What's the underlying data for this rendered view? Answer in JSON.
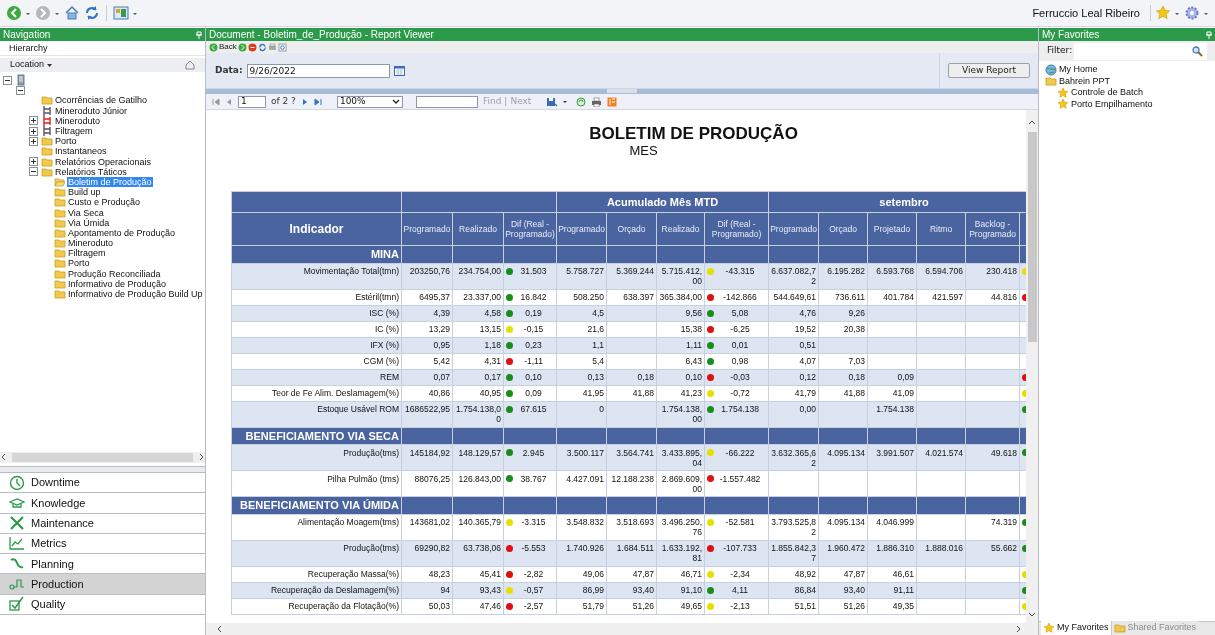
{
  "top_bar": {
    "user_name": "Ferruccio Leal Ribeiro"
  },
  "navigation": {
    "title": "Navigation",
    "mode": "Hierarchy",
    "location": "Location",
    "tree": [
      {
        "kind": "server",
        "expanded": true,
        "children": [
          {
            "expanded": true,
            "children": [
              {
                "label": "Ocorrências de Gatilho",
                "kind": "folder",
                "selected": false
              },
              {
                "label": "Mineroduto Júnior",
                "kind": "unit",
                "selected": false
              },
              {
                "label": "Mineroduto",
                "kind": "alert-unit",
                "expanded": false,
                "selected": false
              },
              {
                "label": "Filtragem",
                "kind": "unit",
                "expanded": false,
                "selected": false
              },
              {
                "label": "Porto",
                "kind": "folder",
                "expanded": false,
                "selected": false
              },
              {
                "label": "Instantaneos",
                "kind": "folder",
                "selected": false
              },
              {
                "label": "Relatórios Operacionais",
                "kind": "folder",
                "expanded": false,
                "selected": false
              },
              {
                "label": "Relatórios Táticos",
                "kind": "folder",
                "expanded": true,
                "selected": false,
                "children": [
                  {
                    "label": "Boletim de Produção",
                    "kind": "folder",
                    "selected": true
                  },
                  {
                    "label": "Build up",
                    "kind": "folder",
                    "selected": false
                  },
                  {
                    "label": "Custo e Produção",
                    "kind": "folder",
                    "selected": false
                  },
                  {
                    "label": "Via Seca",
                    "kind": "folder",
                    "selected": false
                  },
                  {
                    "label": "Via Úmida",
                    "kind": "folder",
                    "selected": false
                  },
                  {
                    "label": "Apontamento de Produção",
                    "kind": "folder",
                    "selected": false
                  },
                  {
                    "label": "Mineroduto",
                    "kind": "folder",
                    "selected": false
                  },
                  {
                    "label": "Filtragem",
                    "kind": "folder",
                    "selected": false
                  },
                  {
                    "label": "Porto",
                    "kind": "folder",
                    "selected": false
                  },
                  {
                    "label": "Produção Reconciliada",
                    "kind": "folder",
                    "selected": false
                  },
                  {
                    "label": "Informativo de Produção",
                    "kind": "folder",
                    "selected": false
                  },
                  {
                    "label": "Informativo de Produção Build Up",
                    "kind": "folder",
                    "selected": false
                  }
                ]
              }
            ]
          }
        ]
      }
    ],
    "sections": [
      {
        "label": "Downtime",
        "selected": false
      },
      {
        "label": "Knowledge",
        "selected": false
      },
      {
        "label": "Maintenance",
        "selected": false
      },
      {
        "label": "Metrics",
        "selected": false
      },
      {
        "label": "Planning",
        "selected": false
      },
      {
        "label": "Production",
        "selected": true
      },
      {
        "label": "Quality",
        "selected": false
      }
    ]
  },
  "document": {
    "title": "Document - Boletim_de_Produção - Report Viewer",
    "back_label": "Back",
    "parameter": {
      "label": "Data:",
      "value": "9/26/2022"
    },
    "view_report": "View Report",
    "toolbar": {
      "page": "1",
      "page_count": "of 2 ?",
      "zoom": "100%",
      "find": "Find",
      "separator": "|",
      "next": "Next",
      "find_disabled": true
    },
    "report": {
      "title": "BOLETIM DE PRODUÇÃO",
      "subtitle": "MES",
      "table": {
        "indicator_header": "Indicador",
        "groups": [
          {
            "columns": [
              "Programado",
              "Realizado",
              "Dif (Real - Programado)"
            ]
          },
          {
            "label": "Acumulado Mês MTD",
            "columns": [
              "Programado",
              "Orçado",
              "Realizado",
              "Dif (Real - Programado)"
            ]
          },
          {
            "label": "setembro",
            "columns": [
              "Programado",
              "Orçado",
              "Projetado",
              "Ritmo",
              "Backlog - Programado"
            ]
          }
        ],
        "rows": [
          {
            "kind": "section",
            "label": "MINA"
          },
          {
            "kind": "data",
            "label": "Movimentação Total(tmn)",
            "shaded": true,
            "programado": "203250,76",
            "realizado": "234.754,00",
            "dif": {
              "text": "31.503",
              "color": "#1a8c1a"
            },
            "mtd_programado": "5.758.727",
            "mtd_orcado": "5.369.244",
            "mtd_realizado": "5.715.412,00",
            "mtd_dif": {
              "text": "-43.315",
              "color": "#e6e000"
            },
            "set_programado": "6.637.082,72",
            "set_orcado": "6.195.282",
            "set_projetado": "6.593.768",
            "set_ritmo": "6.594.706",
            "set_backlog": "230.418",
            "status": {
              "color": "#e6e000"
            }
          },
          {
            "kind": "data",
            "label": "Estéril(tmn)",
            "shaded": false,
            "programado": "6495,37",
            "realizado": "23.337,00",
            "dif": {
              "text": "16.842",
              "color": "#1a8c1a"
            },
            "mtd_programado": "508.250",
            "mtd_orcado": "638.397",
            "mtd_realizado": "365.384,00",
            "mtd_dif": {
              "text": "-142.866",
              "color": "#e01010"
            },
            "set_programado": "544.649,61",
            "set_orcado": "736.611",
            "set_projetado": "401.784",
            "set_ritmo": "421.597",
            "set_backlog": "44.816",
            "status": {
              "color": "#e01010"
            }
          },
          {
            "kind": "data",
            "label": "ISC (%)",
            "shaded": true,
            "programado": "4,39",
            "realizado": "4,58",
            "dif": {
              "text": "0,19",
              "color": "#1a8c1a"
            },
            "mtd_programado": "4,5",
            "mtd_realizado": "9,56",
            "mtd_dif": {
              "text": "5,08",
              "color": "#1a8c1a"
            },
            "set_programado": "4,76",
            "set_orcado": "9,26"
          },
          {
            "kind": "data",
            "label": "IC (%)",
            "shaded": false,
            "programado": "13,29",
            "realizado": "13,15",
            "dif": {
              "text": "-0,15",
              "color": "#e6e000"
            },
            "mtd_programado": "21,6",
            "mtd_realizado": "15,38",
            "mtd_dif": {
              "text": "-6,25",
              "color": "#e01010"
            },
            "set_programado": "19,52",
            "set_orcado": "20,38"
          },
          {
            "kind": "data",
            "label": "IFX (%)",
            "shaded": true,
            "programado": "0,95",
            "realizado": "1,18",
            "dif": {
              "text": "0,23",
              "color": "#1a8c1a"
            },
            "mtd_programado": "1,1",
            "mtd_realizado": "1,11",
            "mtd_dif": {
              "text": "0,01",
              "color": "#1a8c1a"
            },
            "set_programado": "0,51"
          },
          {
            "kind": "data",
            "label": "CGM (%)",
            "shaded": false,
            "programado": "5,42",
            "realizado": "4,31",
            "dif": {
              "text": "-1,11",
              "color": "#e01010"
            },
            "mtd_programado": "5,4",
            "mtd_realizado": "6,43",
            "mtd_dif": {
              "text": "0,98",
              "color": "#1a8c1a"
            },
            "set_programado": "4,07",
            "set_orcado": "7,03"
          },
          {
            "kind": "data",
            "label": "REM",
            "shaded": true,
            "programado": "0,07",
            "realizado": "0,17",
            "dif": {
              "text": "0,10",
              "color": "#1a8c1a"
            },
            "mtd_programado": "0,13",
            "mtd_orcado": "0,18",
            "mtd_realizado": "0,10",
            "mtd_dif": {
              "text": "-0,03",
              "color": "#e01010"
            },
            "set_programado": "0,12",
            "set_orcado": "0,18",
            "set_projetado": "0,09",
            "status": {
              "color": "#e01010"
            }
          },
          {
            "kind": "data",
            "label": "Teor de Fe Alim. Deslamagem(%)",
            "shaded": false,
            "programado": "40,86",
            "realizado": "40,95",
            "dif": {
              "text": "0,09",
              "color": "#1a8c1a"
            },
            "mtd_programado": "41,95",
            "mtd_orcado": "41,88",
            "mtd_realizado": "41,23",
            "mtd_dif": {
              "text": "-0,72",
              "color": "#e6e000"
            },
            "set_programado": "41,79",
            "set_orcado": "41,88",
            "set_projetado": "41,09",
            "status": {
              "color": "#e6e000"
            }
          },
          {
            "kind": "data",
            "label": "Estoque Usável ROM",
            "shaded": true,
            "programado": "1686522,95",
            "realizado": "1.754.138,00",
            "dif": {
              "text": "67.615",
              "color": "#1a8c1a"
            },
            "mtd_programado": "0",
            "mtd_realizado": "1.754.138,00",
            "mtd_dif": {
              "text": "1.754.138",
              "color": "#1a8c1a"
            },
            "set_programado": "0,00",
            "set_projetado": "1.754.138",
            "status": {
              "color": "#1a8c1a"
            }
          },
          {
            "kind": "section",
            "label": "BENEFICIAMENTO VIA SECA"
          },
          {
            "kind": "data",
            "label": "Produção(tms)",
            "shaded": true,
            "programado": "145184,92",
            "realizado": "148.129,57",
            "dif": {
              "text": "2.945",
              "color": "#1a8c1a"
            },
            "mtd_programado": "3.500.117",
            "mtd_orcado": "3.564.741",
            "mtd_realizado": "3.433.895,04",
            "mtd_dif": {
              "text": "-66.222",
              "color": "#e6e000"
            },
            "set_programado": "3.632.365,62",
            "set_orcado": "4.095.134",
            "set_projetado": "3.991.507",
            "set_ritmo": "4.021.574",
            "set_backlog": "49.618",
            "status": {
              "color": "#1a8c1a"
            }
          },
          {
            "kind": "data",
            "label": "Pilha Pulmão (tms)",
            "shaded": false,
            "programado": "88076,25",
            "realizado": "126.843,00",
            "dif": {
              "text": "38.767",
              "color": "#1a8c1a"
            },
            "mtd_programado": "4.427.091",
            "mtd_orcado": "12.188.238",
            "mtd_realizado": "2.869.609,00",
            "mtd_dif": {
              "text": "-1.557.482",
              "color": "#e01010"
            }
          },
          {
            "kind": "section",
            "label": "BENEFICIAMENTO VIA ÚMIDA"
          },
          {
            "kind": "data",
            "label": "Alimentação Moagem(tms)",
            "shaded": false,
            "programado": "143681,02",
            "realizado": "140.365,79",
            "dif": {
              "text": "-3.315",
              "color": "#e6e000"
            },
            "mtd_programado": "3.548.832",
            "mtd_orcado": "3.518.693",
            "mtd_realizado": "3.496.250,76",
            "mtd_dif": {
              "text": "-52.581",
              "color": "#e6e000"
            },
            "set_programado": "3.793.525,82",
            "set_orcado": "4.095.134",
            "set_projetado": "4.046.999",
            "set_backlog": "74.319",
            "status": {
              "color": "#1a8c1a"
            }
          },
          {
            "kind": "data",
            "label": "Produção(tms)",
            "shaded": true,
            "programado": "69290,82",
            "realizado": "63.738,06",
            "dif": {
              "text": "-5.553",
              "color": "#e01010"
            },
            "mtd_programado": "1.740.926",
            "mtd_orcado": "1.684.511",
            "mtd_realizado": "1.633.192,81",
            "mtd_dif": {
              "text": "-107.733",
              "color": "#e01010"
            },
            "set_programado": "1.855.842,37",
            "set_orcado": "1.960.472",
            "set_projetado": "1.886.310",
            "set_ritmo": "1.888.016",
            "set_backlog": "55.662",
            "status": {
              "color": "#1a8c1a"
            }
          },
          {
            "kind": "data",
            "label": "Recuperação Massa(%)",
            "shaded": false,
            "programado": "48,23",
            "realizado": "45,41",
            "dif": {
              "text": "-2,82",
              "color": "#e01010"
            },
            "mtd_programado": "49,06",
            "mtd_orcado": "47,87",
            "mtd_realizado": "46,71",
            "mtd_dif": {
              "text": "-2,34",
              "color": "#e6e000"
            },
            "set_programado": "48,92",
            "set_orcado": "47,87",
            "set_projetado": "46,61",
            "status": {
              "color": "#e6e000"
            }
          },
          {
            "kind": "data",
            "label": "Recuperação da Deslamagem(%)",
            "shaded": true,
            "programado": "94",
            "realizado": "93,43",
            "dif": {
              "text": "-0,57",
              "color": "#e6e000"
            },
            "mtd_programado": "86,99",
            "mtd_orcado": "93,40",
            "mtd_realizado": "91,10",
            "mtd_dif": {
              "text": "4,11",
              "color": "#1a8c1a"
            },
            "set_programado": "86,84",
            "set_orcado": "93,40",
            "set_projetado": "91,11",
            "status": {
              "color": "#1a8c1a"
            }
          },
          {
            "kind": "data",
            "label": "Recuperação da Flotação(%)",
            "shaded": false,
            "programado": "50,03",
            "realizado": "47,46",
            "dif": {
              "text": "-2,57",
              "color": "#e01010"
            },
            "mtd_programado": "51,79",
            "mtd_orcado": "51,26",
            "mtd_realizado": "49,65",
            "mtd_dif": {
              "text": "-2,13",
              "color": "#e6e000"
            },
            "set_programado": "51,51",
            "set_orcado": "51,26",
            "set_projetado": "49,35",
            "status": {
              "color": "#e6e000"
            }
          }
        ]
      }
    }
  },
  "favorites": {
    "title": "My Favorites",
    "filter_label": "Filter:",
    "tree": [
      {
        "label": "My Home",
        "kind": "home"
      },
      {
        "label": "Bahrein PPT",
        "kind": "folder",
        "children": [
          {
            "label": "Controle de Batch",
            "kind": "favorite"
          },
          {
            "label": "Porto Empilhamento",
            "kind": "favorite"
          }
        ]
      }
    ],
    "tabs": [
      {
        "label": "My Favorites",
        "selected": true
      },
      {
        "label": "Shared Favorites",
        "selected": false
      }
    ]
  }
}
